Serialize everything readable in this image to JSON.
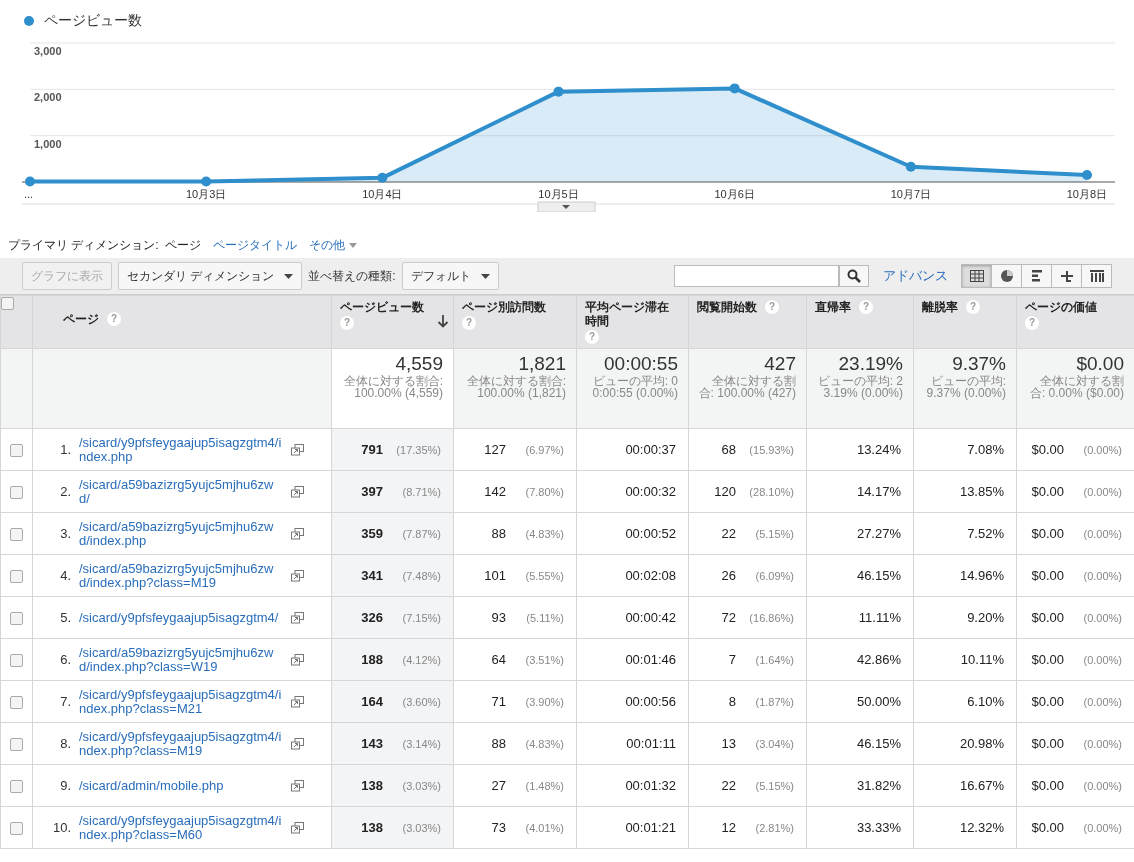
{
  "chart": {
    "chart_data": {
      "type": "area",
      "categories": [
        "...",
        "10月3日",
        "10月4日",
        "10月5日",
        "10月6日",
        "10月7日",
        "10月8日"
      ],
      "series": [
        {
          "name": "ページビュー数",
          "color": "#2e8fcc",
          "values": [
            10,
            10,
            90,
            1950,
            2020,
            330,
            150
          ]
        }
      ],
      "ylim": [
        0,
        3000
      ],
      "yticks": [
        {
          "value": 1000,
          "label": "1,000"
        },
        {
          "value": 2000,
          "label": "2,000"
        },
        {
          "value": 3000,
          "label": "3,000"
        }
      ]
    }
  },
  "primary_dimension": {
    "label": "プライマリ ディメンション:",
    "options": [
      {
        "label": "ページ",
        "selected": true,
        "caret": false
      },
      {
        "label": "ページタイトル",
        "selected": false,
        "caret": false
      },
      {
        "label": "その他",
        "selected": false,
        "caret": true
      }
    ]
  },
  "toolbar": {
    "graph_button": {
      "label": "グラフに表示",
      "disabled": true
    },
    "secondary_dimension": "セカンダリ ディメンション",
    "sort_label": "並べ替えの種類:",
    "sort_value": "デフォルト",
    "advanced": "アドバンス",
    "views": [
      {
        "kind": "table",
        "selected": true
      },
      {
        "kind": "pie",
        "selected": false
      },
      {
        "kind": "bars",
        "selected": false
      },
      {
        "kind": "compare",
        "selected": false
      },
      {
        "kind": "pivot",
        "selected": false
      }
    ]
  },
  "table": {
    "select_all_checked": false,
    "columns": [
      {
        "label": "ページ",
        "help": "?",
        "sorted": false
      },
      {
        "label": "ページビュー数",
        "help": "?",
        "sorted": true
      },
      {
        "label": "ページ別訪問数",
        "help": "?",
        "sorted": false
      },
      {
        "label": "平均ページ滞在時間",
        "help": "?",
        "sorted": false
      },
      {
        "label": "閲覧開始数",
        "help": "?",
        "sorted": false
      },
      {
        "label": "直帰率",
        "help": "?",
        "sorted": false
      },
      {
        "label": "離脱率",
        "help": "?",
        "sorted": false
      },
      {
        "label": "ページの価値",
        "help": "?",
        "sorted": false
      }
    ],
    "totals": [
      {
        "value": "4,559",
        "note": "全体に対する割合: 100.00% (4,559)"
      },
      {
        "value": "1,821",
        "note": "全体に対する割合: 100.00% (1,821)"
      },
      {
        "value": "00:00:55",
        "note": "ビューの平均: 00:00:55 (0.00%)"
      },
      {
        "value": "427",
        "note": "全体に対する割合: 100.00% (427)"
      },
      {
        "value": "23.19%",
        "note": "ビューの平均: 23.19% (0.00%)"
      },
      {
        "value": "9.37%",
        "note": "ビューの平均: 9.37% (0.00%)"
      },
      {
        "value": "$0.00",
        "note": "全体に対する割合: 0.00% ($0.00)"
      }
    ],
    "rows": [
      {
        "checked": false,
        "index": "1.",
        "page": "/sicard/y9pfsfeygaajup5isagzgtm4/index.php",
        "pageviews": "791",
        "pageviews_pct": "(17.35%)",
        "unique": "127",
        "unique_pct": "(6.97%)",
        "avg_time": "00:00:37",
        "entrances": "68",
        "entrances_pct": "(15.93%)",
        "bounce": "13.24%",
        "exit": "7.08%",
        "value": "$0.00",
        "value_pct": "(0.00%)"
      },
      {
        "checked": false,
        "index": "2.",
        "page": "/sicard/a59bazizrg5yujc5mjhu6zwd/",
        "pageviews": "397",
        "pageviews_pct": "(8.71%)",
        "unique": "142",
        "unique_pct": "(7.80%)",
        "avg_time": "00:00:32",
        "entrances": "120",
        "entrances_pct": "(28.10%)",
        "bounce": "14.17%",
        "exit": "13.85%",
        "value": "$0.00",
        "value_pct": "(0.00%)"
      },
      {
        "checked": false,
        "index": "3.",
        "page": "/sicard/a59bazizrg5yujc5mjhu6zwd/index.php",
        "pageviews": "359",
        "pageviews_pct": "(7.87%)",
        "unique": "88",
        "unique_pct": "(4.83%)",
        "avg_time": "00:00:52",
        "entrances": "22",
        "entrances_pct": "(5.15%)",
        "bounce": "27.27%",
        "exit": "7.52%",
        "value": "$0.00",
        "value_pct": "(0.00%)"
      },
      {
        "checked": false,
        "index": "4.",
        "page": "/sicard/a59bazizrg5yujc5mjhu6zwd/index.php?class=M19",
        "pageviews": "341",
        "pageviews_pct": "(7.48%)",
        "unique": "101",
        "unique_pct": "(5.55%)",
        "avg_time": "00:02:08",
        "entrances": "26",
        "entrances_pct": "(6.09%)",
        "bounce": "46.15%",
        "exit": "14.96%",
        "value": "$0.00",
        "value_pct": "(0.00%)"
      },
      {
        "checked": false,
        "index": "5.",
        "page": "/sicard/y9pfsfeygaajup5isagzgtm4/",
        "pageviews": "326",
        "pageviews_pct": "(7.15%)",
        "unique": "93",
        "unique_pct": "(5.11%)",
        "avg_time": "00:00:42",
        "entrances": "72",
        "entrances_pct": "(16.86%)",
        "bounce": "11.11%",
        "exit": "9.20%",
        "value": "$0.00",
        "value_pct": "(0.00%)"
      },
      {
        "checked": false,
        "index": "6.",
        "page": "/sicard/a59bazizrg5yujc5mjhu6zwd/index.php?class=W19",
        "pageviews": "188",
        "pageviews_pct": "(4.12%)",
        "unique": "64",
        "unique_pct": "(3.51%)",
        "avg_time": "00:01:46",
        "entrances": "7",
        "entrances_pct": "(1.64%)",
        "bounce": "42.86%",
        "exit": "10.11%",
        "value": "$0.00",
        "value_pct": "(0.00%)"
      },
      {
        "checked": false,
        "index": "7.",
        "page": "/sicard/y9pfsfeygaajup5isagzgtm4/index.php?class=M21",
        "pageviews": "164",
        "pageviews_pct": "(3.60%)",
        "unique": "71",
        "unique_pct": "(3.90%)",
        "avg_time": "00:00:56",
        "entrances": "8",
        "entrances_pct": "(1.87%)",
        "bounce": "50.00%",
        "exit": "6.10%",
        "value": "$0.00",
        "value_pct": "(0.00%)"
      },
      {
        "checked": false,
        "index": "8.",
        "page": "/sicard/y9pfsfeygaajup5isagzgtm4/index.php?class=M19",
        "pageviews": "143",
        "pageviews_pct": "(3.14%)",
        "unique": "88",
        "unique_pct": "(4.83%)",
        "avg_time": "00:01:11",
        "entrances": "13",
        "entrances_pct": "(3.04%)",
        "bounce": "46.15%",
        "exit": "20.98%",
        "value": "$0.00",
        "value_pct": "(0.00%)"
      },
      {
        "checked": false,
        "index": "9.",
        "page": "/sicard/admin/mobile.php",
        "pageviews": "138",
        "pageviews_pct": "(3.03%)",
        "unique": "27",
        "unique_pct": "(1.48%)",
        "avg_time": "00:01:32",
        "entrances": "22",
        "entrances_pct": "(5.15%)",
        "bounce": "31.82%",
        "exit": "16.67%",
        "value": "$0.00",
        "value_pct": "(0.00%)"
      },
      {
        "checked": false,
        "index": "10.",
        "page": "/sicard/y9pfsfeygaajup5isagzgtm4/index.php?class=M60",
        "pageviews": "138",
        "pageviews_pct": "(3.03%)",
        "unique": "73",
        "unique_pct": "(4.01%)",
        "avg_time": "00:01:21",
        "entrances": "12",
        "entrances_pct": "(2.81%)",
        "bounce": "33.33%",
        "exit": "12.32%",
        "value": "$0.00",
        "value_pct": "(0.00%)"
      }
    ]
  }
}
